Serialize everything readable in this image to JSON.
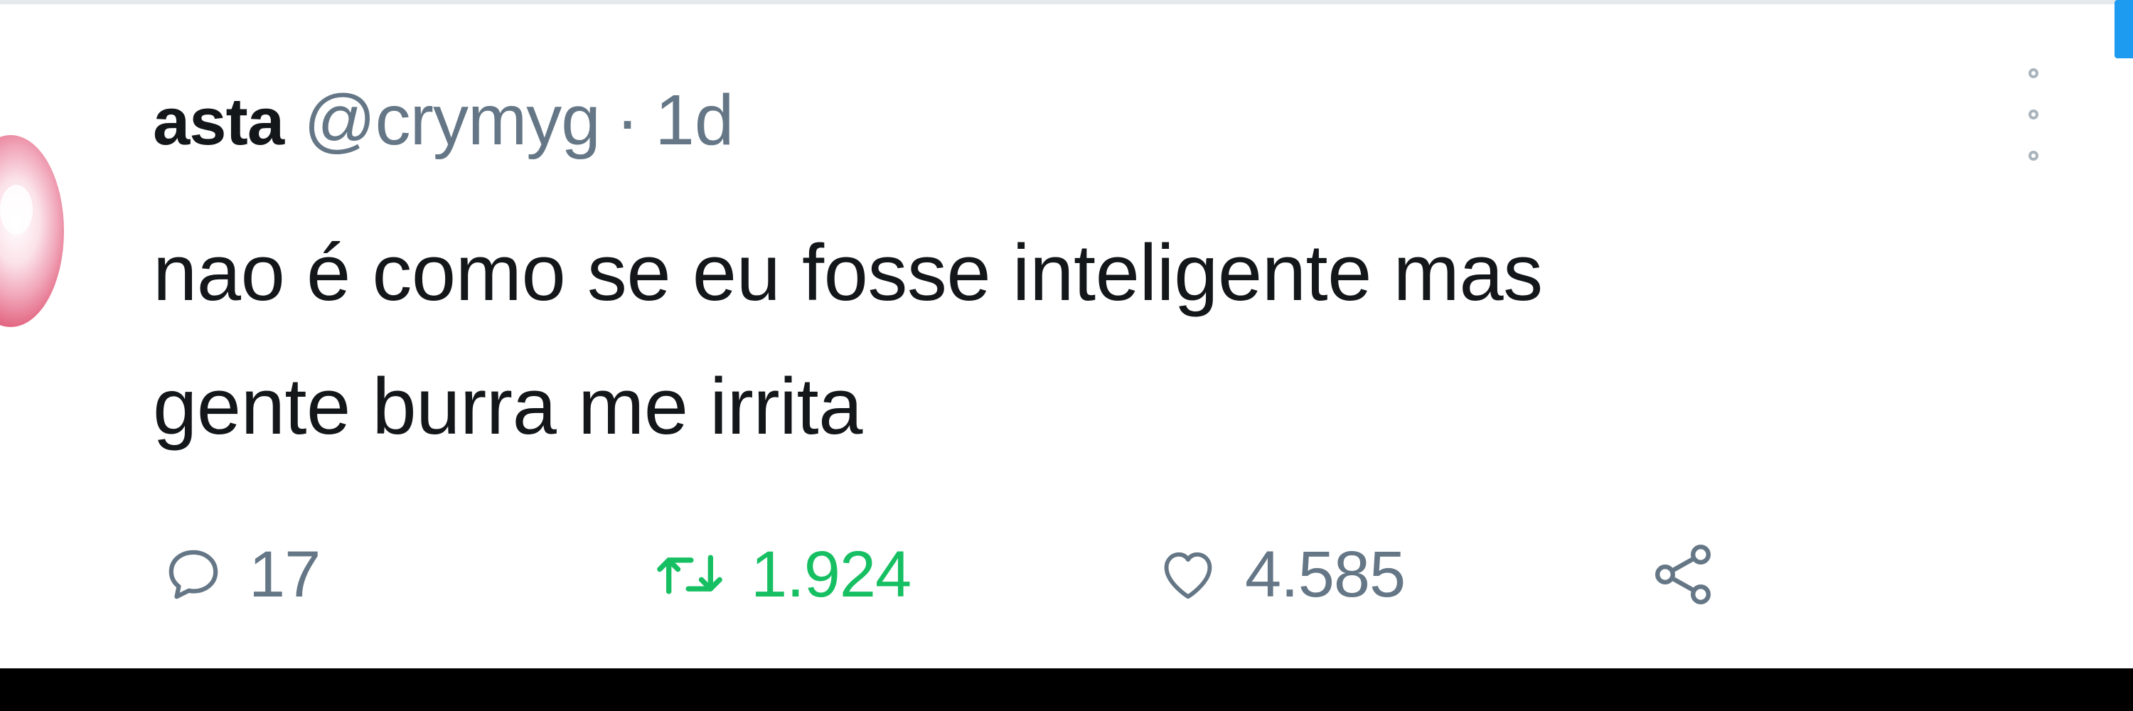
{
  "tweet": {
    "display_name": "asta",
    "handle": "@crymyg",
    "separator": "·",
    "timestamp": "1d",
    "text_lines": [
      "nao é como se eu fosse inteligente mas",
      "gente burra me irrita"
    ]
  },
  "actions": {
    "reply": {
      "icon": "reply-icon",
      "count": "17"
    },
    "retweet": {
      "icon": "retweet-icon",
      "count": "1.924",
      "color": "#17bf63"
    },
    "like": {
      "icon": "heart-icon",
      "count": "4.585"
    },
    "share": {
      "icon": "share-icon"
    }
  },
  "colors": {
    "text": "#14171a",
    "secondary": "#657786",
    "retweet_active": "#17bf63",
    "accent": "#1d9bf0"
  }
}
